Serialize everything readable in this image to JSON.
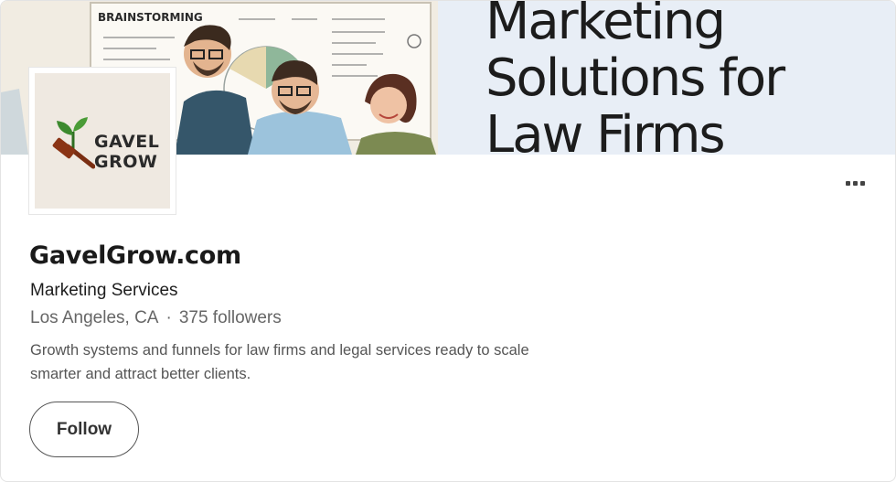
{
  "banner": {
    "art_label": "BRAINSTORMING",
    "headline_lines": [
      "Marketing",
      "Solutions for",
      "Law Firms"
    ]
  },
  "logo": {
    "line1": "GAVEL",
    "line2": "GROW",
    "icon": "gavel-sprout-icon"
  },
  "more_menu": {
    "icon": "more-horizontal-icon"
  },
  "company": {
    "name": "GavelGrow.com",
    "industry": "Marketing Services",
    "location": "Los Angeles, CA",
    "separator": "·",
    "followers": "375 followers",
    "tagline": "Growth systems and funnels for law firms and legal services ready to scale smarter and attract better clients."
  },
  "actions": {
    "follow_label": "Follow"
  },
  "colors": {
    "banner_panel": "#e8eef6",
    "logo_green": "#3c8a2e",
    "gavel_brown": "#7a2e12",
    "button_border": "#555555"
  }
}
